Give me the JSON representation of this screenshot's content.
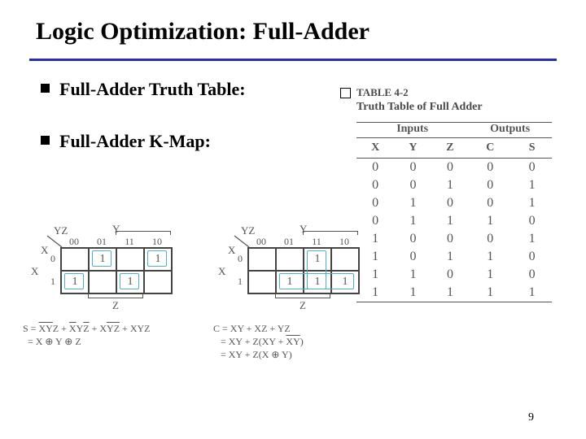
{
  "title": "Logic Optimization: Full-Adder",
  "bullets": {
    "truth": "Full-Adder Truth Table:",
    "kmap": "Full-Adder K-Map:"
  },
  "truth": {
    "caption": "TABLE 4-2",
    "title": "Truth Table of Full Adder",
    "group_inputs": "Inputs",
    "group_outputs": "Outputs",
    "cols": [
      "X",
      "Y",
      "Z",
      "C",
      "S"
    ],
    "rows": [
      [
        0,
        0,
        0,
        0,
        0
      ],
      [
        0,
        0,
        1,
        0,
        1
      ],
      [
        0,
        1,
        0,
        0,
        1
      ],
      [
        0,
        1,
        1,
        1,
        0
      ],
      [
        1,
        0,
        0,
        0,
        1
      ],
      [
        1,
        0,
        1,
        1,
        0
      ],
      [
        1,
        1,
        0,
        1,
        0
      ],
      [
        1,
        1,
        1,
        1,
        1
      ]
    ]
  },
  "chart_data": {
    "type": "table",
    "title": "Full-Adder Karnaugh Maps (2×4, vars X / YZ in Gray-code order 00 01 11 10)",
    "maps": [
      {
        "output": "S",
        "col_labels": [
          "00",
          "01",
          "11",
          "10"
        ],
        "row_labels": [
          "0",
          "1"
        ],
        "grid": [
          [
            0,
            1,
            0,
            1
          ],
          [
            1,
            0,
            1,
            0
          ]
        ],
        "equations": [
          "S = X̄ȲZ + X̄YZ̄ + XȲZ̄ + XYZ",
          "  = X ⊕ Y ⊕ Z"
        ]
      },
      {
        "output": "C",
        "col_labels": [
          "00",
          "01",
          "11",
          "10"
        ],
        "row_labels": [
          "0",
          "1"
        ],
        "grid": [
          [
            0,
            0,
            1,
            0
          ],
          [
            0,
            1,
            1,
            1
          ]
        ],
        "equations": [
          "C = XY + XZ + YZ",
          "  = XY + Z(XY + X̄Ȳ)",
          "  = XY + Z(X ⊕ Y)"
        ]
      }
    ]
  },
  "kmap_labels": {
    "YZ": "YZ",
    "X": "X",
    "Y": "Y",
    "Z": "Z",
    "X1": "X"
  },
  "page": "9"
}
